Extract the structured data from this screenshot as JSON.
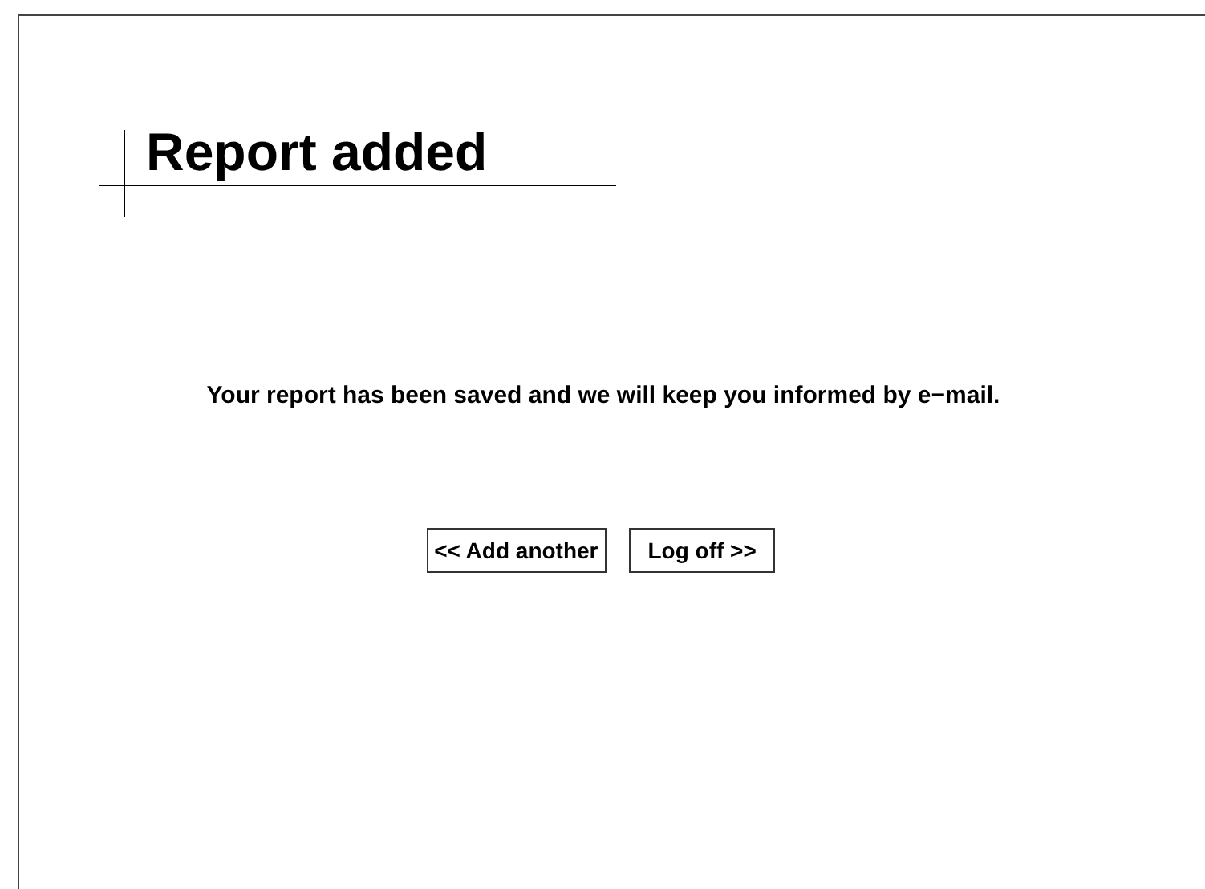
{
  "title": "Report added",
  "message": "Your report has been saved and we will keep you informed by e−mail.",
  "buttons": [
    {
      "label": "<< Add another",
      "kind": "back"
    },
    {
      "label": "Log off >>",
      "kind": "forward"
    }
  ]
}
